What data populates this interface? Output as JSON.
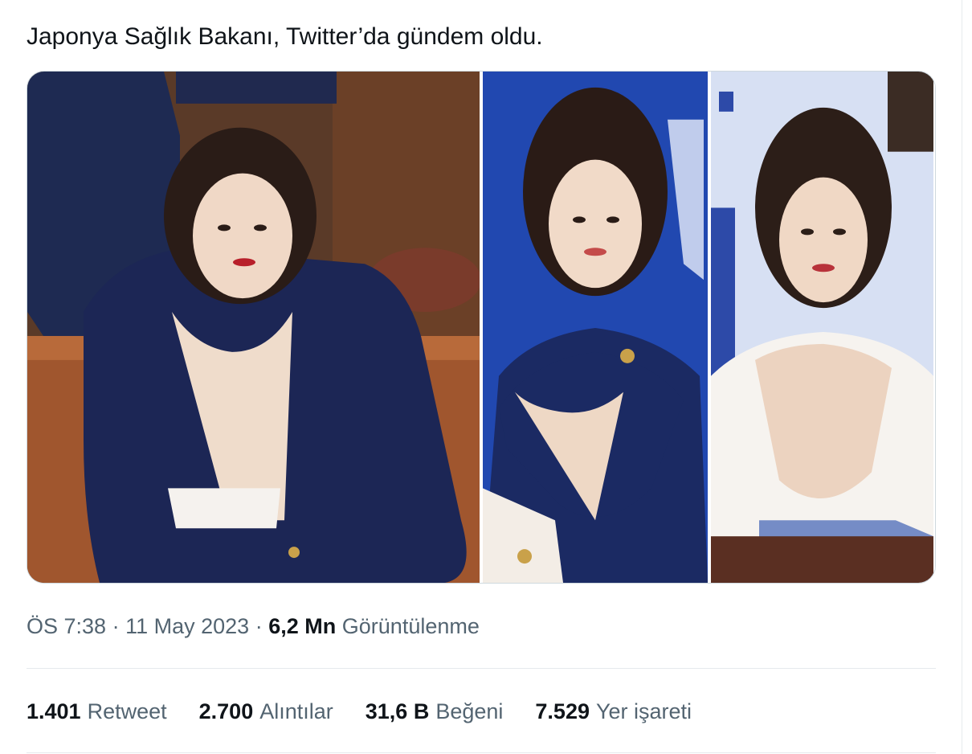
{
  "tweet": {
    "text": "Japonya Sağlık Bakanı, Twitter’da gündem oldu."
  },
  "media": {
    "photos": [
      {
        "description_icon": "photo-parliament-icon"
      },
      {
        "description_icon": "photo-podium-icon"
      },
      {
        "description_icon": "photo-stage-icon"
      }
    ]
  },
  "meta": {
    "time": "ÖS 7:38",
    "separator_1": "·",
    "date": "11 May 2023",
    "separator_2": "·",
    "views_count": "6,2 Mn",
    "views_label": "Görüntülenme"
  },
  "stats": [
    {
      "count": "1.401",
      "label": "Retweet"
    },
    {
      "count": "2.700",
      "label": "Alıntılar"
    },
    {
      "count": "31,6 B",
      "label": "Beğeni"
    },
    {
      "count": "7.529",
      "label": "Yer işareti"
    }
  ],
  "colors": {
    "text_primary": "#0f1419",
    "text_secondary": "#536471",
    "divider": "#e6eaed"
  }
}
